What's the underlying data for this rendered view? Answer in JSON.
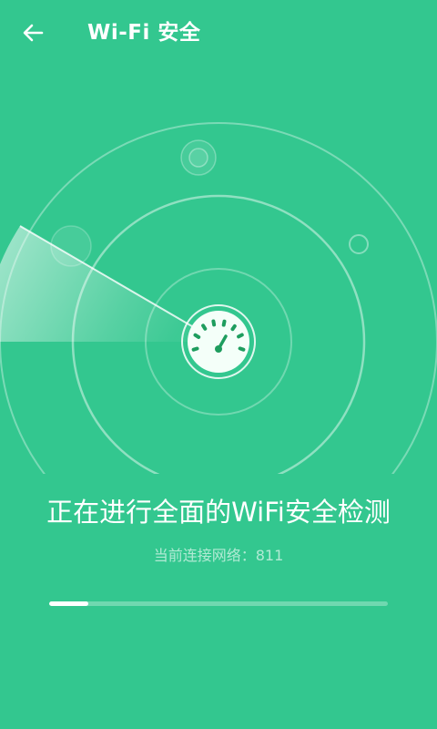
{
  "header": {
    "title": "Wi-Fi 安全",
    "back_icon": "arrow-left-icon"
  },
  "scan": {
    "status_text": "正在进行全面的WiFi安全检测",
    "network_label": "当前连接网络：",
    "network_name": "811",
    "progress": 0.115,
    "center_icon": "speedometer-icon"
  },
  "colors": {
    "background": "#33c78f",
    "gauge_green": "#1e9d5e"
  }
}
